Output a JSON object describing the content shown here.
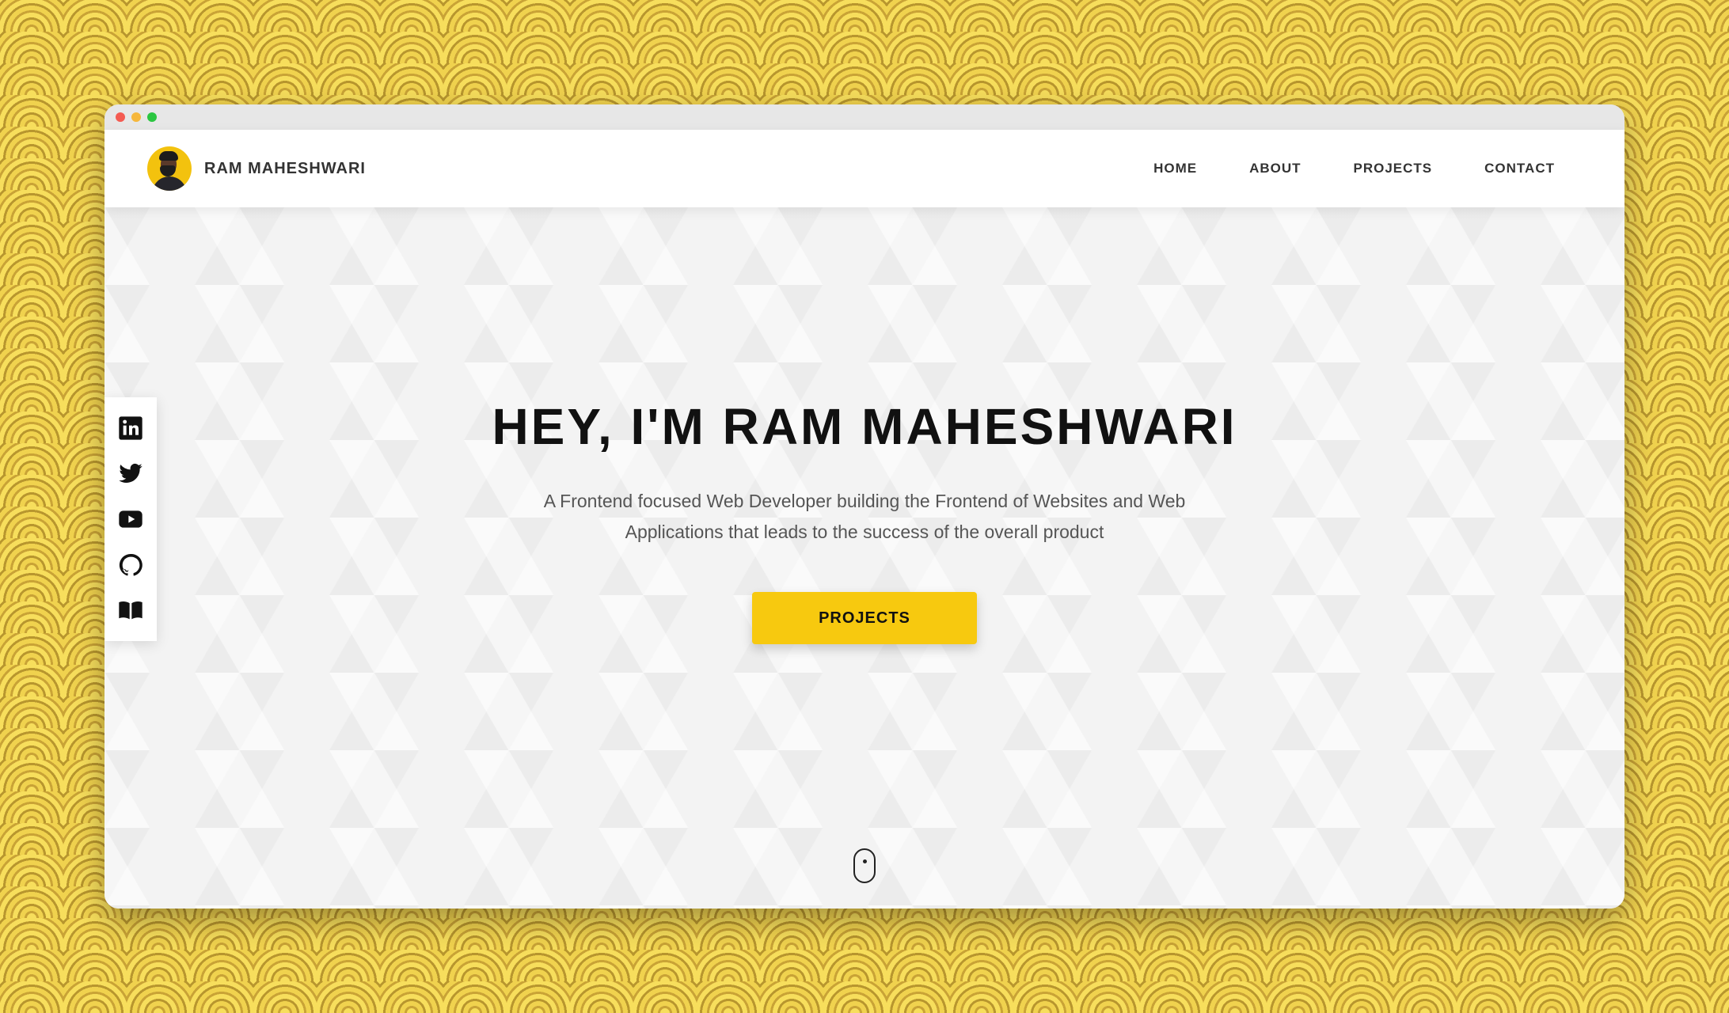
{
  "window": {
    "controls": [
      "close",
      "minimize",
      "maximize"
    ]
  },
  "header": {
    "brand_name": "RAM MAHESHWARI",
    "nav": [
      {
        "label": "HOME"
      },
      {
        "label": "ABOUT"
      },
      {
        "label": "PROJECTS"
      },
      {
        "label": "CONTACT"
      }
    ]
  },
  "hero": {
    "title": "HEY, I'M RAM MAHESHWARI",
    "description": "A Frontend focused Web Developer building the Frontend of Websites and Web Applications that leads to the success of the overall product",
    "cta_label": "PROJECTS"
  },
  "social": {
    "icons": [
      "linkedin-icon",
      "twitter-icon",
      "youtube-icon",
      "github-icon",
      "book-icon"
    ]
  },
  "colors": {
    "accent": "#f7c90f",
    "background_pattern": "#f2d24a",
    "text_dark": "#111111"
  }
}
